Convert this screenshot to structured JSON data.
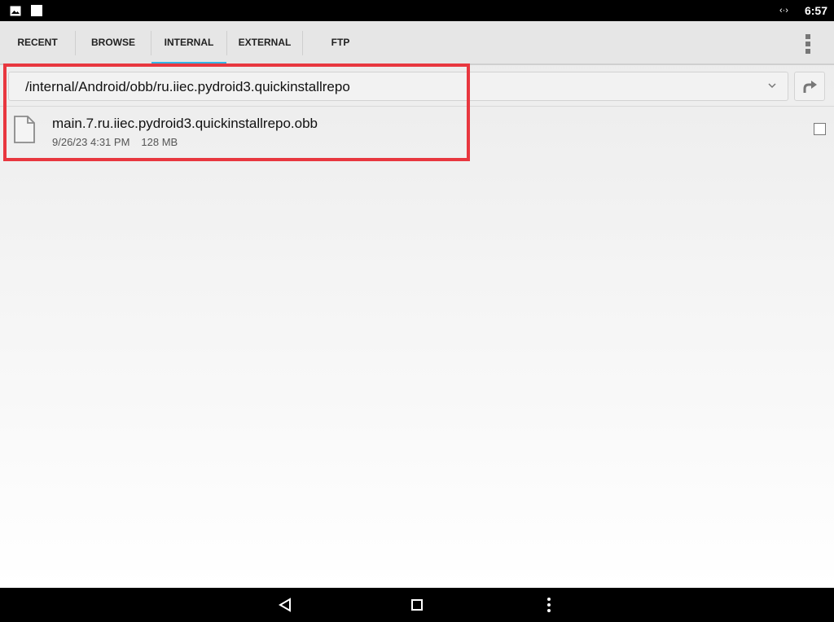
{
  "status_bar": {
    "time": "6:57",
    "net_glyph": "‹·›",
    "icons": [
      "image-notification-icon",
      "square-notification-icon",
      "data-transfer-icon"
    ]
  },
  "tabs": [
    {
      "label": "RECENT",
      "active": false
    },
    {
      "label": "BROWSE",
      "active": false
    },
    {
      "label": "INTERNAL",
      "active": true
    },
    {
      "label": "EXTERNAL",
      "active": false
    },
    {
      "label": "FTP",
      "active": false
    }
  ],
  "path": {
    "value": "/internal/Android/obb/ru.iiec.pydroid3.quickinstallrepo"
  },
  "files": [
    {
      "name": "main.7.ru.iiec.pydroid3.quickinstallrepo.obb",
      "date": "9/26/23 4:31 PM",
      "size": "128 MB",
      "icon": "file-icon",
      "checked": false
    }
  ],
  "colors": {
    "accent": "#33b5e5",
    "highlight": "#e8373f"
  },
  "navbar": {
    "buttons": [
      "back-icon",
      "recents-icon",
      "menu-icon"
    ]
  }
}
